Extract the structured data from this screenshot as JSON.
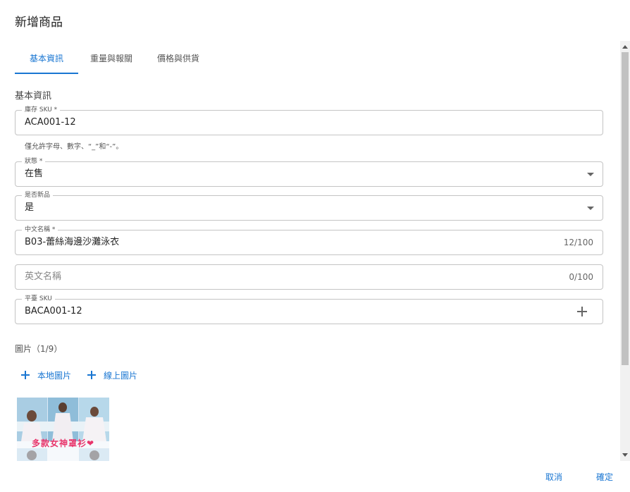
{
  "dialog": {
    "title": "新增商品"
  },
  "tabs": [
    {
      "label": "基本資訊"
    },
    {
      "label": "重量與報關"
    },
    {
      "label": "價格與供貨"
    }
  ],
  "section": {
    "title": "基本資訊"
  },
  "fields": {
    "sku": {
      "label": "庫存 SKU *",
      "value": "ACA001-12",
      "helper": "僅允許字母、數字、“_”和“-”。"
    },
    "status": {
      "label": "狀態 *",
      "value": "在售"
    },
    "is_new": {
      "label": "是否新品",
      "value": "是"
    },
    "name_zh": {
      "label": "中文名稱 *",
      "value": "B03-蕾絲海邊沙灘泳衣",
      "counter": "12/100"
    },
    "name_en": {
      "placeholder": "英文名稱",
      "counter": "0/100"
    },
    "platform_sku": {
      "label": "平臺 SKU",
      "value": "BACA001-12"
    }
  },
  "images": {
    "title": "圖片（1/9）",
    "local_label": "本地圖片",
    "online_label": "線上圖片",
    "thumb_caption": "多款女神罩衫❤"
  },
  "footer": {
    "cancel_label": "取消",
    "confirm_label": "確定"
  },
  "colors": {
    "accent": "#1976d2"
  }
}
